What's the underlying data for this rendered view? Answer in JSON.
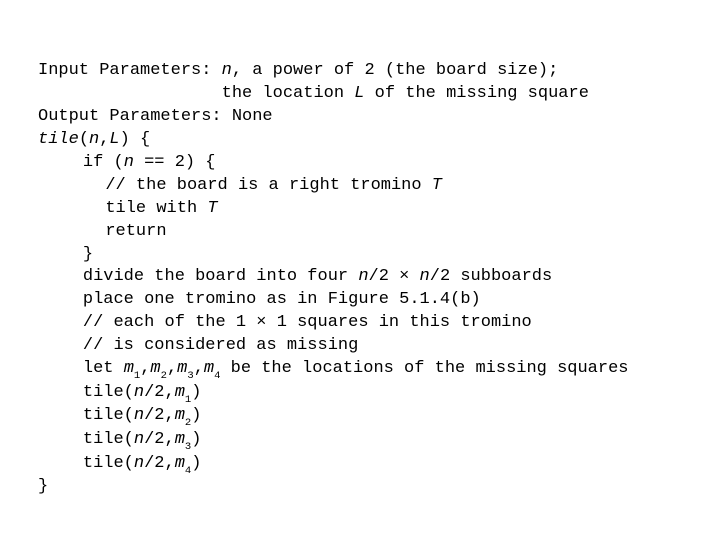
{
  "l1a": "Input Parameters: ",
  "l1b": "n",
  "l1c": ", a power of 2 (the board size);",
  "l2a": "the location ",
  "l2b": "L",
  "l2c": " of the missing square",
  "l3": "Output Parameters: None",
  "l4a": "tile",
  "l4b": "(",
  "l4c": "n",
  "l4d": ",",
  "l4e": "L",
  "l4f": ") {",
  "l5a": "if (",
  "l5b": "n",
  "l5c": " == 2) {",
  "l6a": "// the board is a right tromino ",
  "l6b": "T",
  "l7a": "tile with ",
  "l7b": "T",
  "l8": "return",
  "l9": "}",
  "l10a": "divide the board into four ",
  "l10b": "n",
  "l10c": "/2 × ",
  "l10d": "n",
  "l10e": "/2 subboards",
  "l11": "place one tromino as in Figure 5.1.4(b)",
  "l12": "// each of the 1 × 1 squares in this tromino",
  "l13": "// is considered as missing",
  "l14a": "let ",
  "l14b": "m",
  "l14s1": "1",
  "l14c": ",",
  "l14d": "m",
  "l14s2": "2",
  "l14e": ",",
  "l14f": "m",
  "l14s3": "3",
  "l14g": ",",
  "l14h": "m",
  "l14s4": "4",
  "l14i": " be the locations of the missing squares",
  "l15a": "tile(",
  "l15b": "n",
  "l15c": "/2,",
  "l15d": "m",
  "l15s": "1",
  "l15e": ")",
  "l16a": "tile(",
  "l16b": "n",
  "l16c": "/2,",
  "l16d": "m",
  "l16s": "2",
  "l16e": ")",
  "l17a": "tile(",
  "l17b": "n",
  "l17c": "/2,",
  "l17d": "m",
  "l17s": "3",
  "l17e": ")",
  "l18a": "tile(",
  "l18b": "n",
  "l18c": "/2,",
  "l18d": "m",
  "l18s": "4",
  "l18e": ")",
  "l19": "}"
}
